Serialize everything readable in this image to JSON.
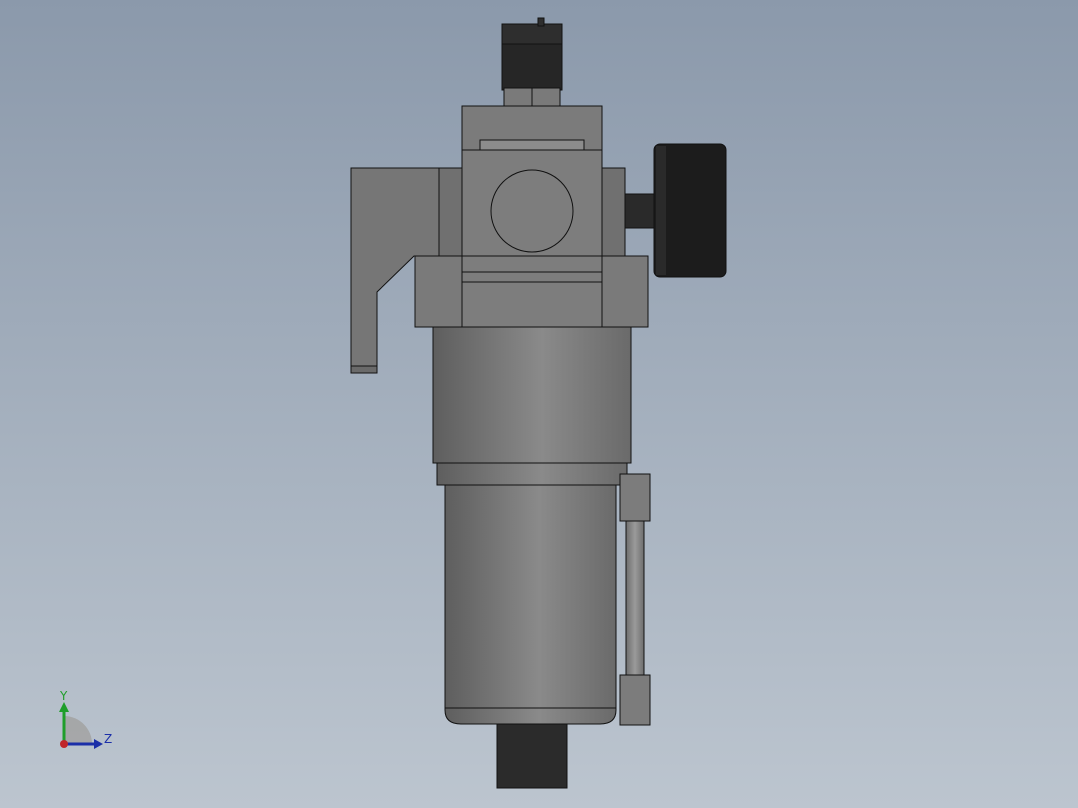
{
  "viewport": {
    "background_top": "#8b99ab",
    "background_bottom": "#bcc5cf"
  },
  "model": {
    "body_color": "#787878",
    "dark_color": "#2b2b2b",
    "edge_color": "#111111"
  },
  "triad": {
    "y_label": "Y",
    "z_label": "Z",
    "y_color": "#1f9e2a",
    "z_color": "#1b2fa8",
    "x_color": "#c0262b"
  }
}
